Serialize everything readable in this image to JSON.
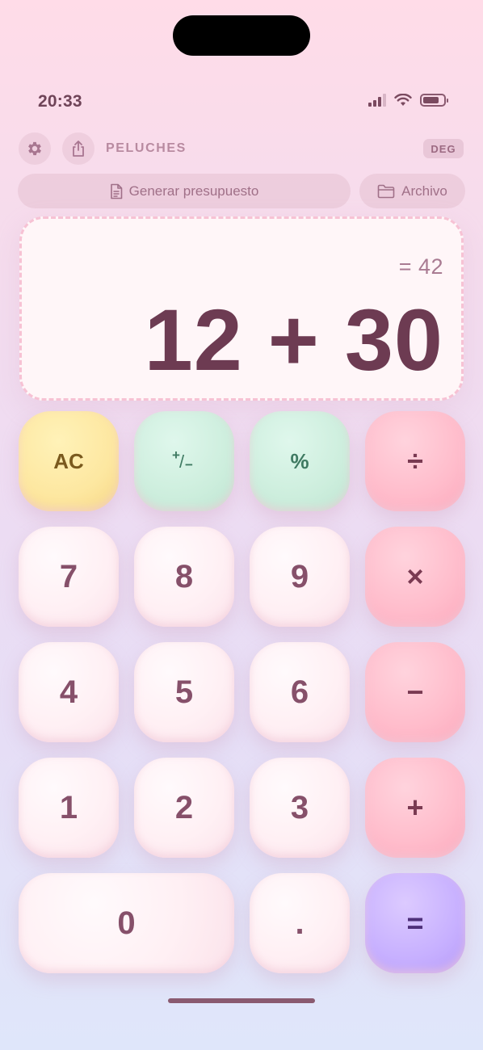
{
  "status_bar": {
    "time": "20:33",
    "signal_icon": "cellular-signal-icon",
    "wifi_icon": "wifi-icon",
    "battery_icon": "battery-icon",
    "battery_level": 0.8
  },
  "toolbar": {
    "settings_icon": "gear-icon",
    "share_icon": "share-icon",
    "title": "PELUCHES",
    "angle_mode": "DEG",
    "budget_label": "Generar presupuesto",
    "budget_icon": "document-icon",
    "archive_label": "Archivo",
    "archive_icon": "folder-icon"
  },
  "display": {
    "result": "= 42",
    "expression": "12 + 30"
  },
  "keypad": {
    "clear": "AC",
    "sign_toggle_plus": "+",
    "sign_toggle_slash": "/",
    "sign_toggle_minus": "−",
    "percent": "%",
    "divide": "÷",
    "multiply": "×",
    "subtract": "−",
    "add": "+",
    "equals": "=",
    "decimal": ".",
    "digits": [
      "0",
      "1",
      "2",
      "3",
      "4",
      "5",
      "6",
      "7",
      "8",
      "9"
    ]
  },
  "colors": {
    "clear_key": "#fde7a0",
    "function_keys": "#cdeedd",
    "operator_keys": "#ffbccb",
    "equals_key": "#c7b0ff",
    "digit_keys": "#fff0f4",
    "text_primary": "#6d3b52"
  }
}
